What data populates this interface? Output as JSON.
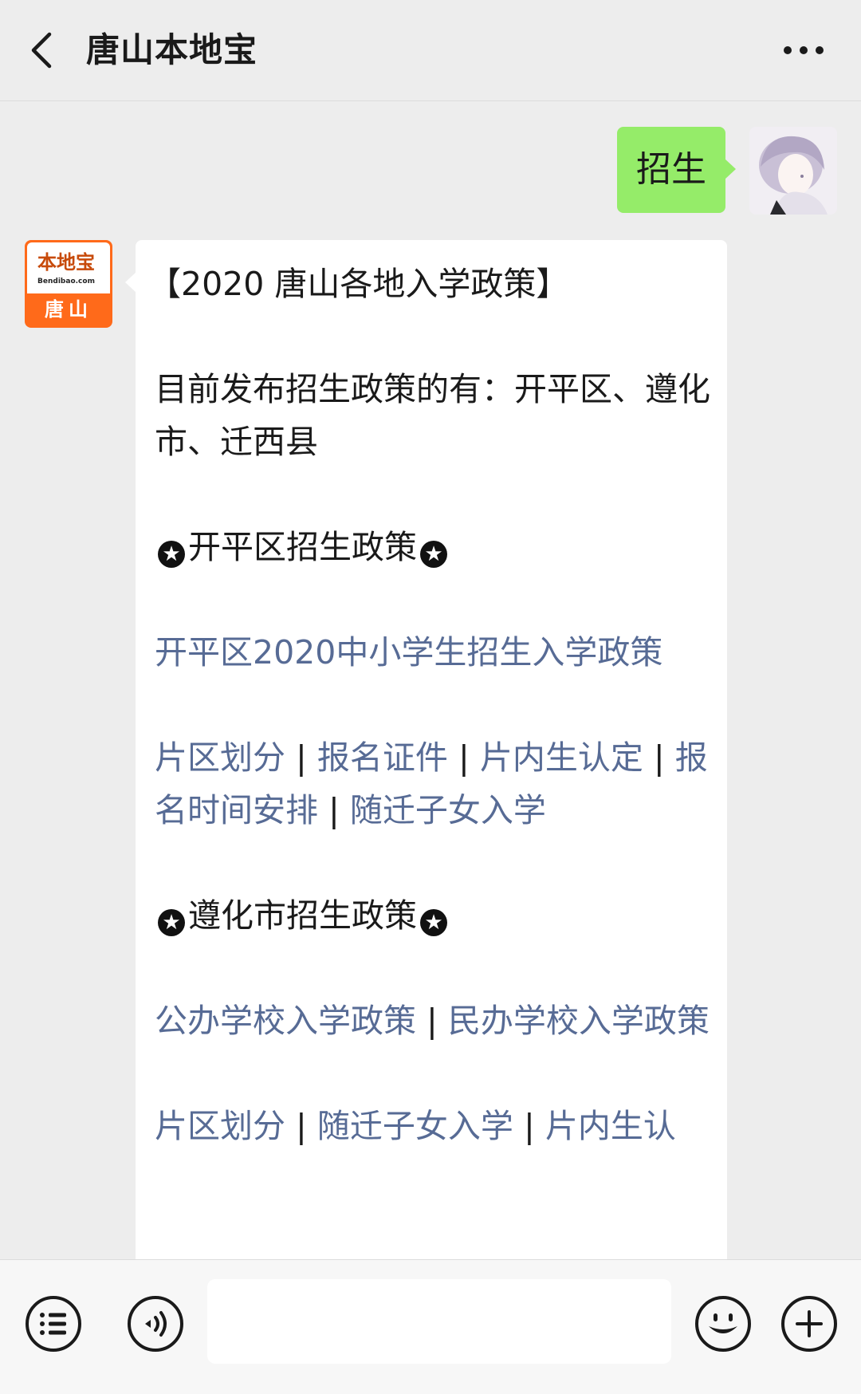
{
  "header": {
    "title": "唐山本地宝",
    "back_icon": "chevron-left-icon",
    "more_icon": "more-dots-icon"
  },
  "messages": {
    "user": {
      "text": "招生",
      "avatar": "anime-character-avatar"
    },
    "bot": {
      "avatar": {
        "logo_text": "本地宝",
        "logo_url": "Bendibao.com",
        "city": "唐山"
      },
      "title": "【2020 唐山各地入学政策】",
      "intro": "目前发布招生政策的有：开平区、遵化市、迁西县",
      "sections": [
        {
          "heading": "开平区招生政策",
          "main_link": "开平区2020中小学生招生入学政策",
          "links": [
            "片区划分",
            "报名证件",
            "片内生认定",
            "报名时间安排",
            "随迁子女入学"
          ]
        },
        {
          "heading": "遵化市招生政策",
          "main_links": [
            "公办学校入学政策",
            "民办学校入学政策"
          ],
          "links": [
            "片区划分",
            "随迁子女入学",
            "片内生认"
          ]
        }
      ],
      "separator": "|",
      "star_icon": "star-badge-icon"
    }
  },
  "input_bar": {
    "menu_icon": "list-menu-icon",
    "voice_icon": "voice-icon",
    "emoji_icon": "emoji-icon",
    "add_icon": "plus-icon",
    "text_value": ""
  },
  "colors": {
    "user_bubble": "#95ec69",
    "link": "#576b95",
    "brand_orange": "#ff6a1a"
  }
}
